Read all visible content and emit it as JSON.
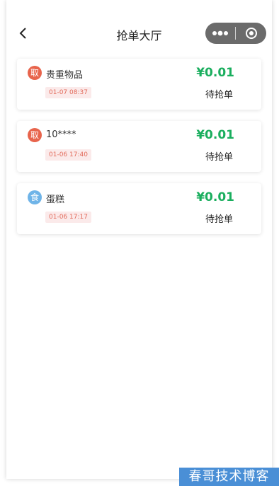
{
  "navbar": {
    "title": "抢单大厅",
    "back_icon": "chevron-left-icon",
    "more_icon": "more-dots-icon",
    "close_icon": "target-close-icon"
  },
  "orders": [
    {
      "category_label": "取",
      "category_color": "#e8644c",
      "name": "贵重物品",
      "time": "01-07 08:37",
      "price": "¥0.01",
      "status": "待抢单"
    },
    {
      "category_label": "取",
      "category_color": "#e8644c",
      "name": "10****",
      "time": "01-06 17:40",
      "price": "¥0.01",
      "status": "待抢单"
    },
    {
      "category_label": "食",
      "category_color": "#6fb4e8",
      "name": "蛋糕",
      "time": "01-06 17:17",
      "price": "¥0.01",
      "status": "待抢单"
    }
  ],
  "watermark": "春哥技术博客"
}
